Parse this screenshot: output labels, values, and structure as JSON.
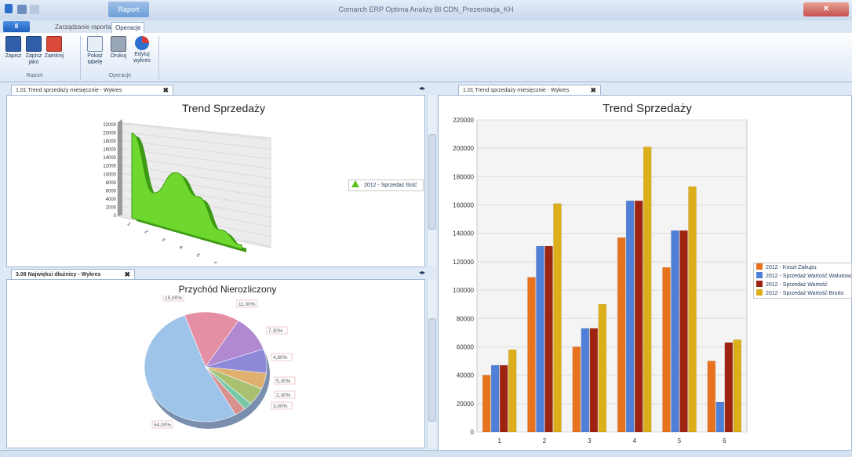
{
  "window": {
    "title": "Comarch ERP Optima Analizy BI CDN_Prezentacja_KH",
    "context_tab": "Raport"
  },
  "ribbon": {
    "app_button": "8",
    "tabs": [
      {
        "label": "Zarządzanie raportami"
      },
      {
        "label": "Operacje"
      }
    ],
    "groups": {
      "raport": {
        "label": "Raport",
        "buttons": [
          {
            "label": "Zapisz"
          },
          {
            "label": "Zapisz jako"
          },
          {
            "label": "Zamknij"
          }
        ]
      },
      "operacje": {
        "label": "Operacje",
        "buttons": [
          {
            "label": "Pokaż tabelę"
          },
          {
            "label": "Drukuj"
          },
          {
            "label": "Edytuj wykres"
          }
        ]
      }
    }
  },
  "panels": {
    "top_left": {
      "tab": "1.01 Trend sprzedaży miesięcznie - Wykres",
      "title": "Trend Sprzedaży",
      "legend": "2012 - Sprzedaż Ilość",
      "y_ticks": [
        "22000",
        "20000",
        "18000",
        "16000",
        "14000",
        "12000",
        "10000",
        "8000",
        "6000",
        "4000",
        "2000",
        "0"
      ],
      "x_ticks": [
        "1",
        "2",
        "3",
        "4",
        "5",
        "6"
      ]
    },
    "bottom_left": {
      "tab": "3.08 Najwięksi dłużnicy - Wykres",
      "title": "Przychód Nierozliczony",
      "slice_labels": [
        "15,00%",
        "11,00%",
        "7,30%",
        "4,80%",
        "5,30%",
        "2,30%",
        "3,00%",
        "54,00%"
      ]
    },
    "right": {
      "tab": "1.01 Trend sprzedaży miesięcznie - Wykres"
    }
  },
  "chart_data": [
    {
      "type": "area",
      "title": "Trend Sprzedaży",
      "categories": [
        "1",
        "2",
        "3",
        "4",
        "5",
        "6"
      ],
      "series": [
        {
          "name": "2012 - Sprzedaż Ilość",
          "values": [
            19000,
            7000,
            13000,
            9000,
            3000,
            1000
          ]
        }
      ],
      "ylim": [
        0,
        22000
      ],
      "legend": "right",
      "color": "#5bc21c"
    },
    {
      "type": "pie",
      "title": "Przychód Nierozliczony",
      "labels": [
        "15,00%",
        "11,00%",
        "7,30%",
        "4,80%",
        "5,30%",
        "2,30%",
        "3,00%",
        "54,00%"
      ],
      "values": [
        15.0,
        11.0,
        7.3,
        4.8,
        5.3,
        2.3,
        3.0,
        54.0
      ],
      "colors": [
        "#e58fa5",
        "#b089d2",
        "#8d88d8",
        "#e0b070",
        "#a8c070",
        "#78c8a8",
        "#d89090",
        "#9ec4ea"
      ]
    },
    {
      "type": "bar",
      "title": "Trend Sprzedaży",
      "categories": [
        "1",
        "2",
        "3",
        "4",
        "5",
        "6"
      ],
      "series": [
        {
          "name": "2012 - Koszt Zakupu",
          "values": [
            40000,
            109000,
            60000,
            137000,
            116000,
            50000
          ],
          "color": "#e8731e"
        },
        {
          "name": "2012 - Sprzedaż Wartość Walutowa",
          "values": [
            47000,
            131000,
            73000,
            163000,
            142000,
            21000
          ],
          "color": "#4f7fd6"
        },
        {
          "name": "2012 - Sprzedaż Wartość",
          "values": [
            47000,
            131000,
            73000,
            163000,
            142000,
            63000
          ],
          "color": "#9e2412"
        },
        {
          "name": "2012 - Sprzedaż Wartość Brutto",
          "values": [
            58000,
            161000,
            90000,
            201000,
            173000,
            65000
          ],
          "color": "#dcaf1a"
        }
      ],
      "y_ticks": [
        "220000",
        "200000",
        "180000",
        "160000",
        "140000",
        "120000",
        "100000",
        "80000",
        "60000",
        "40000",
        "20000",
        "0"
      ],
      "ylim": [
        0,
        220000
      ],
      "legend": "right",
      "grid": true
    }
  ]
}
